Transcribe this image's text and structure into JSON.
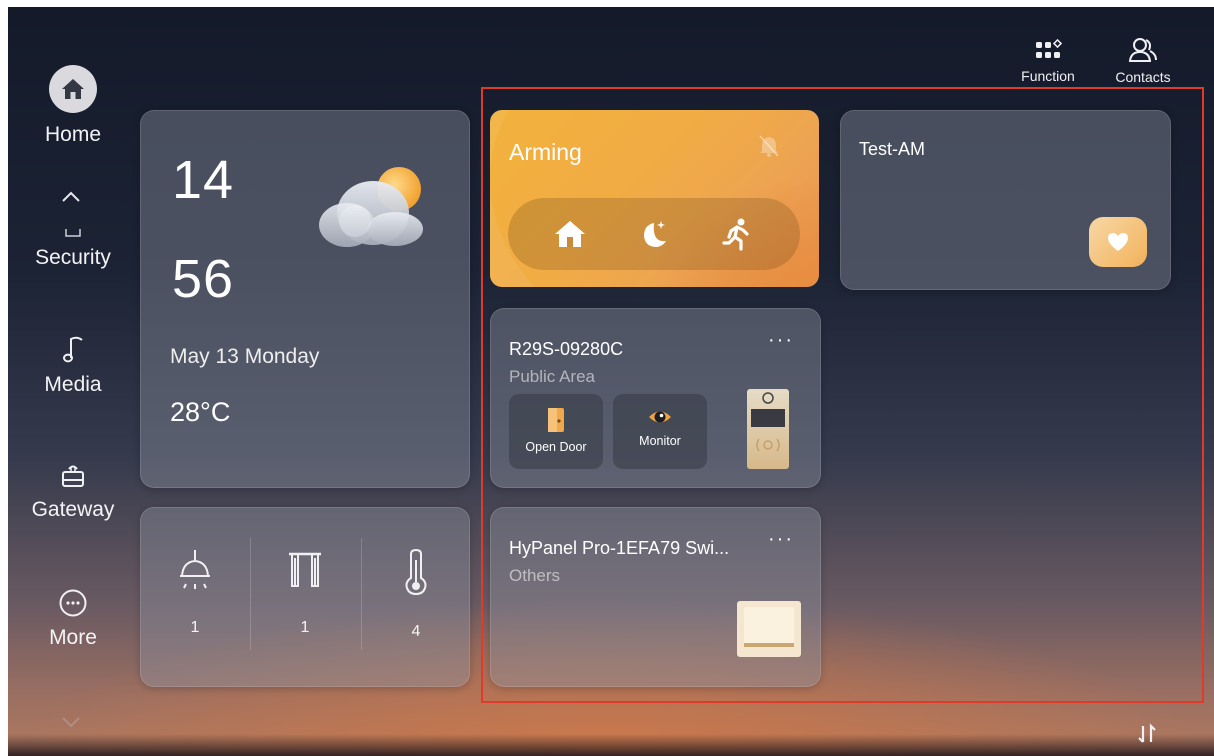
{
  "nav": {
    "items": [
      {
        "label": "Home",
        "icon": "home-icon"
      },
      {
        "label": "Security",
        "icon": "security-icon"
      },
      {
        "label": "Media",
        "icon": "music-note-icon"
      },
      {
        "label": "Gateway",
        "icon": "gateway-icon"
      },
      {
        "label": "More",
        "icon": "more-icon"
      }
    ]
  },
  "top": {
    "function_label": "Function",
    "contacts_label": "Contacts"
  },
  "clock": {
    "hour": "14",
    "minute": "56",
    "date": "May 13  Monday",
    "temperature": "28°C",
    "weather_icon": "partly-cloudy-icon"
  },
  "devices": [
    {
      "icon": "light-icon",
      "count": "1"
    },
    {
      "icon": "curtain-icon",
      "count": "1"
    },
    {
      "icon": "thermometer-icon",
      "count": "4"
    }
  ],
  "arming": {
    "title": "Arming",
    "modes": [
      "home-mode",
      "night-mode",
      "away-mode"
    ]
  },
  "test_am": {
    "title": "Test-AM"
  },
  "door_station": {
    "name": "R29S-09280C",
    "area": "Public Area",
    "menu": "···",
    "open_door_label": "Open Door",
    "monitor_label": "Monitor"
  },
  "switch_panel": {
    "name": "HyPanel Pro-1EFA79 Swi...",
    "area": "Others",
    "menu": "···"
  },
  "colors": {
    "arming_orange": "#f2b23c",
    "highlight_red": "#e03a2a"
  }
}
